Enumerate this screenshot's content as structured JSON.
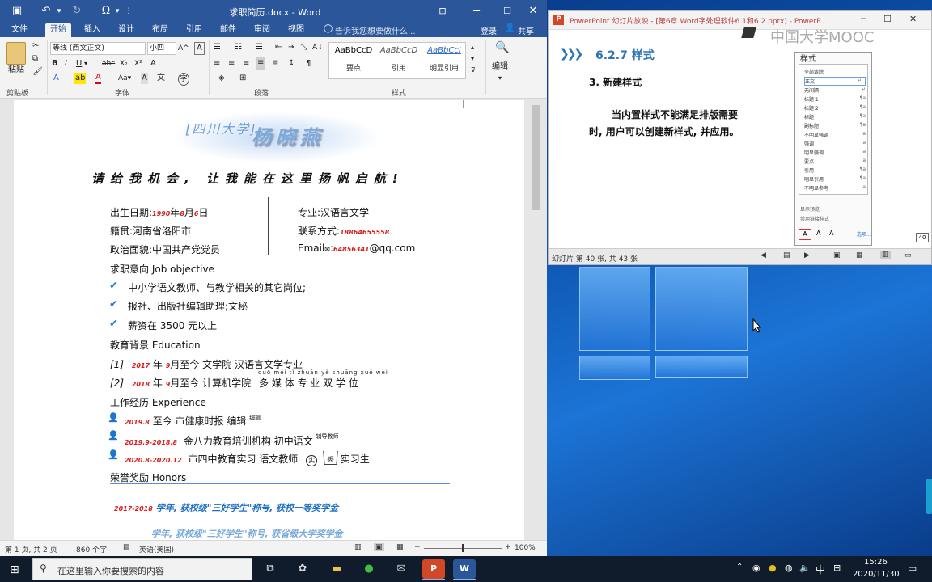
{
  "word": {
    "title": "求职简历.docx - Word",
    "tabs": [
      "文件",
      "开始",
      "插入",
      "设计",
      "布局",
      "引用",
      "邮件",
      "审阅",
      "视图"
    ],
    "tell_me": "告诉我您想要做什么...",
    "login": "登录",
    "share": "共享",
    "ribbon": {
      "paste": "粘贴",
      "clipboard": "剪贴板",
      "font_name": "等线 (西文正文)",
      "font_size": "小四",
      "font_group": "字体",
      "para_group": "段落",
      "styles_group": "样式",
      "edit": "编辑",
      "styles": [
        {
          "sample": "AaBbCcD",
          "name": "要点"
        },
        {
          "sample": "AaBbCcD",
          "name": "引用"
        },
        {
          "sample": "AaBbCcI",
          "name": "明显引用"
        }
      ]
    },
    "doc": {
      "header_small": "[四川大学]",
      "header_name": "杨晓燕",
      "slogan": "请给我机会, 让我能在这里扬帆启航!",
      "birth_label": "出生日期:",
      "birth_year": "1990",
      "birth_month": "8",
      "birth_day": "6",
      "nian": "年",
      "yue": "月",
      "ri": "日",
      "major": "专业:汉语言文学",
      "native": "籍贯:河南省洛阳市",
      "contact_label": "联系方式",
      "phone": "18864655558",
      "politics": "政治面貌:中国共产党党员",
      "email_label": "Email",
      "email_num": "64856341",
      "email_domain": "@qq.com",
      "objective": "求职意向  Job objective",
      "obj_items": [
        "中小学语文教师、与教学相关的其它岗位;",
        "报社、出版社编辑助理;文秘",
        "薪资在 3500 元以上"
      ],
      "edu_title": "教育背景  Education",
      "edu1_idx": "[1]",
      "edu1_year": "2017",
      "edu1_month": "9",
      "edu1_text": "月至今  文学院  汉语言文学专业",
      "edu2_idx": "[2]",
      "edu2_year": "2018",
      "edu2_month": "9",
      "edu2_text": "月至今  计算机学院",
      "edu2_major": "多 媒 体  专  业  双  学  位",
      "edu2_pinyin": "duō méi tǐ  zhuān yè  shuāng xué wèi",
      "work_title": "工作经历  Experience",
      "work1_date": "2019.8",
      "work1_text": "至今  市健康时报  编辑",
      "work1_small": "编辑",
      "work2_date": "2019.9-2018.8",
      "work2_text": "金八力教育培训机构  初中语文",
      "work2_small": "辅导教师",
      "work3_date": "2020.8-2020.12",
      "work3_text": "市四中教育实习  语文教师",
      "work3_circle": "实",
      "work3_tri": "秀",
      "work3_tail": "实习生",
      "honors_title": "荣誉奖励  Honors",
      "honor1_year": "2017-2018",
      "honor1_text": "学年, 获校级\"三好学生\"称号, 获校一等奖学金",
      "honor2_text": "学年, 获校级\"三好学生\"称号, 获省级大学奖学金"
    },
    "status": {
      "page": "第 1 页, 共 2 页",
      "words": "860 个字",
      "lang": "英语(美国)",
      "zoom": "100%"
    }
  },
  "ppt": {
    "title": "PowerPoint 幻灯片放映 - [第6章 Word字处理软件6.1和6.2.pptx] - PowerP...",
    "watermark": "中国大学MOOC",
    "section": "6.2.7  样式",
    "heading": "3. 新建样式",
    "body1": "当内置样式不能满足排版需要",
    "body2": "时, 用户可以创建新样式, 并应用。",
    "pane_title": "样式",
    "pane_items": [
      {
        "name": "全部清除",
        "mark": ""
      },
      {
        "name": "正文",
        "mark": "↵"
      },
      {
        "name": "无间隔",
        "mark": "↵"
      },
      {
        "name": "标题 1",
        "mark": "¶a"
      },
      {
        "name": "标题 2",
        "mark": "¶a"
      },
      {
        "name": "标题",
        "mark": "¶a"
      },
      {
        "name": "副标题",
        "mark": "¶a"
      },
      {
        "name": "不明显强调",
        "mark": "a"
      },
      {
        "name": "强调",
        "mark": "a"
      },
      {
        "name": "明显强调",
        "mark": "a"
      },
      {
        "name": "要点",
        "mark": "a"
      },
      {
        "name": "引用",
        "mark": "¶a"
      },
      {
        "name": "明显引用",
        "mark": "¶a"
      },
      {
        "name": "不明显参考",
        "mark": "a"
      }
    ],
    "pane_opt1": "显示预览",
    "pane_opt2": "禁用链接样式",
    "pane_options": "选项...",
    "slide_num": "40",
    "status": "幻灯片 第 40 张, 共 43 张"
  },
  "taskbar": {
    "search_placeholder": "在这里输入你要搜索的内容",
    "ime": "中",
    "time": "15:26",
    "date": "2020/11/30"
  }
}
